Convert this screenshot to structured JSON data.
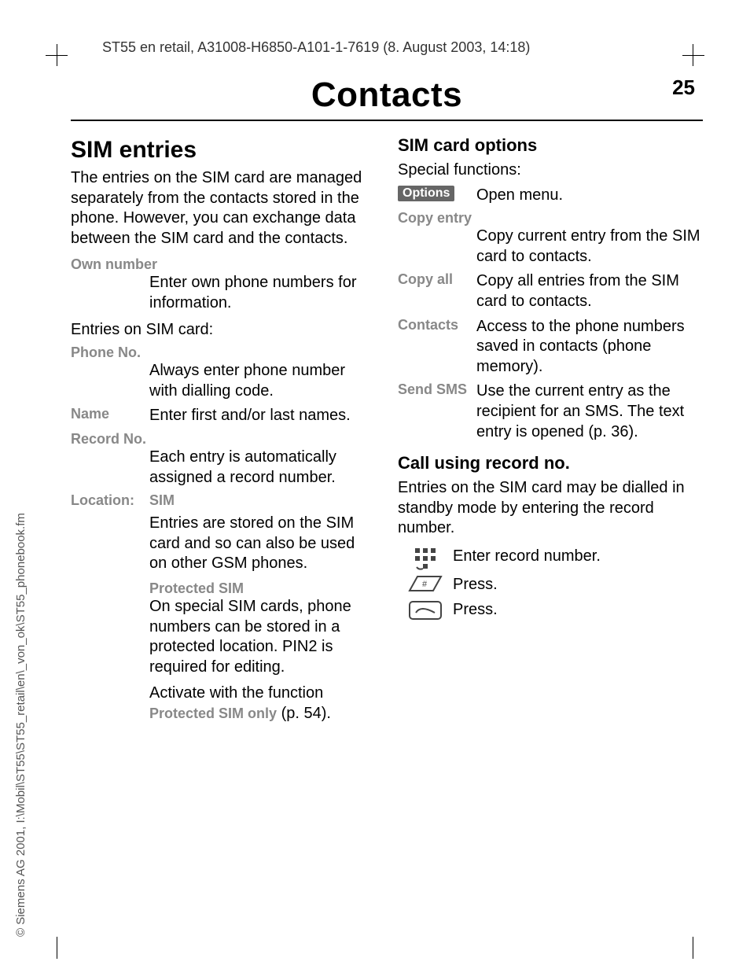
{
  "header": "ST55 en retail, A31008-H6850-A101-1-7619 (8. August 2003, 14:18)",
  "page_title": "Contacts",
  "page_number": "25",
  "left": {
    "h2": "SIM entries",
    "intro": "The entries on the SIM card are managed separately from the contacts stored in the phone. However, you can exchange data between the SIM card and the contacts.",
    "own_number_label": "Own number",
    "own_number_text": "Enter own phone numbers for information.",
    "entries_on_sim": "Entries on SIM card:",
    "phone_no_label": "Phone No.",
    "phone_no_text": "Always enter phone number with dialling code.",
    "name_label": "Name",
    "name_text": "Enter first and/or last names.",
    "record_no_label": "Record No.",
    "record_no_text": "Each entry is automatically assigned a record number.",
    "location_label": "Location:",
    "location_value": "SIM",
    "location_text": "Entries are stored on the SIM card and so can also be used on other GSM phones.",
    "protected_sim_label": "Protected SIM",
    "protected_sim_text": "On special SIM cards, phone numbers can be stored in a protected location. PIN2 is required for editing.",
    "activate_text_1": "Activate with the function ",
    "activate_text_bold": "Protected SIM only",
    "activate_text_2": " (p. 54)."
  },
  "right": {
    "h3a": "SIM card options",
    "special": "Special functions:",
    "options_pill": "Options",
    "open_menu": "Open menu.",
    "copy_entry_label": "Copy entry",
    "copy_entry_text": "Copy current entry from the SIM card to contacts.",
    "copy_all_label": "Copy all",
    "copy_all_text": "Copy all entries from the SIM card to contacts.",
    "contacts_label": "Contacts",
    "contacts_text": "Access to the phone numbers saved in contacts (phone memory).",
    "send_sms_label": "Send SMS",
    "send_sms_text": "Use the current entry as the recipient for an SMS. The text entry is opened (p. 36).",
    "h3b": "Call using record no.",
    "call_intro": "Entries on the SIM card may be dialled in standby mode by entering the record number.",
    "enter_record": "Enter record number.",
    "press1": "Press.",
    "press2": "Press."
  },
  "side": "© Siemens AG 2001, I:\\Mobil\\ST55\\ST55_retail\\en\\_von_ok\\ST55_phonebook.fm"
}
